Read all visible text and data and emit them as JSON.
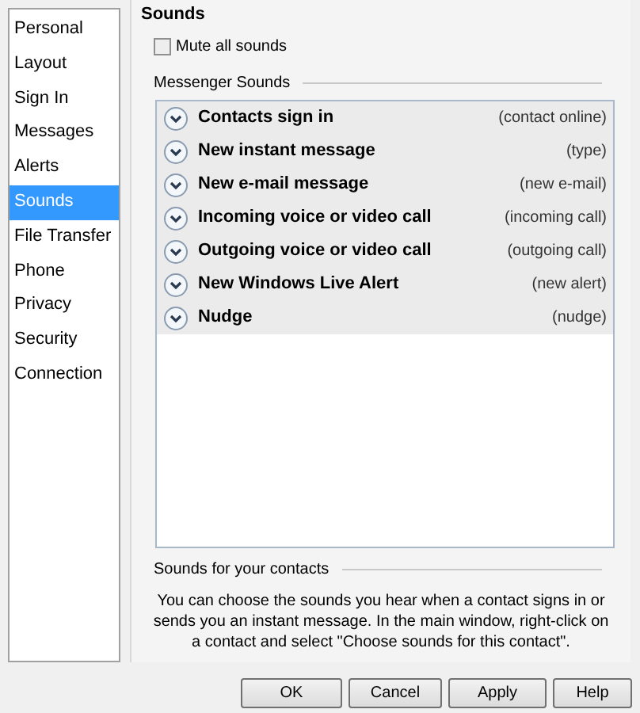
{
  "sidebar": {
    "items": [
      {
        "label": "Personal",
        "selected": false
      },
      {
        "label": "Layout",
        "selected": false
      },
      {
        "label": "Sign In",
        "selected": false
      },
      {
        "label": "Messages",
        "selected": false
      },
      {
        "label": "Alerts",
        "selected": false
      },
      {
        "label": "Sounds",
        "selected": true
      },
      {
        "label": "File Transfer",
        "selected": false
      },
      {
        "label": "Phone",
        "selected": false
      },
      {
        "label": "Privacy",
        "selected": false
      },
      {
        "label": "Security",
        "selected": false
      },
      {
        "label": "Connection",
        "selected": false
      }
    ]
  },
  "section_title": "Sounds",
  "mute": {
    "label": "Mute all sounds",
    "checked": false
  },
  "messenger_sounds": {
    "heading": "Messenger Sounds",
    "items": [
      {
        "name": "Contacts sign in",
        "sound": "(contact online)"
      },
      {
        "name": "New instant message",
        "sound": "(type)"
      },
      {
        "name": "New e-mail message",
        "sound": "(new e-mail)"
      },
      {
        "name": "Incoming voice or video call",
        "sound": "(incoming call)"
      },
      {
        "name": "Outgoing voice or video call",
        "sound": "(outgoing call)"
      },
      {
        "name": "New Windows Live Alert",
        "sound": "(new alert)"
      },
      {
        "name": "Nudge",
        "sound": "(nudge)"
      }
    ]
  },
  "contacts_sounds": {
    "heading": "Sounds for your contacts",
    "text": "You can choose the sounds you hear when a contact signs in or sends you an instant message.  In the main window, right-click on a contact and select \"Choose sounds for this contact\"."
  },
  "buttons": [
    "OK",
    "Cancel",
    "Apply",
    "Help"
  ]
}
